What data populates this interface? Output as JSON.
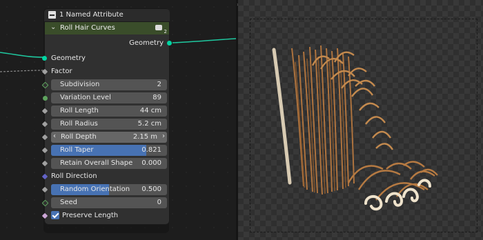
{
  "node_editor": {
    "prev_node": {
      "label": "1 Named Attribute"
    },
    "node": {
      "title": "Roll Hair Curves",
      "badge_count": "2",
      "output": {
        "label": "Geometry"
      },
      "inputs": {
        "geometry": "Geometry",
        "factor": "Factor",
        "subdivision": {
          "label": "Subdivision",
          "value": "2"
        },
        "variation_level": {
          "label": "Variation Level",
          "value": "89"
        },
        "roll_length": {
          "label": "Roll Length",
          "value": "44 cm"
        },
        "roll_radius": {
          "label": "Roll Radius",
          "value": "5.2 cm"
        },
        "roll_depth": {
          "label": "Roll Depth",
          "value": "2.15 m"
        },
        "roll_taper": {
          "label": "Roll Taper",
          "value": "0.821",
          "fill": 0.821
        },
        "retain_overall_shape": {
          "label": "Retain Overall Shape",
          "value": "0.000"
        },
        "roll_direction": "Roll Direction",
        "random_orientation": {
          "label": "Random Orientation",
          "value": "0.500",
          "fill": 0.5
        },
        "seed": {
          "label": "Seed",
          "value": "0"
        },
        "preserve_length": {
          "label": "Preserve Length",
          "checked": true
        }
      }
    },
    "colors": {
      "geometry_socket": "#00d6a3",
      "header": "#3a4d2a",
      "slider_fill": "#4772b3"
    }
  },
  "viewport": {
    "content": "3D render of rolled brown hair curves with a white guide strand"
  }
}
